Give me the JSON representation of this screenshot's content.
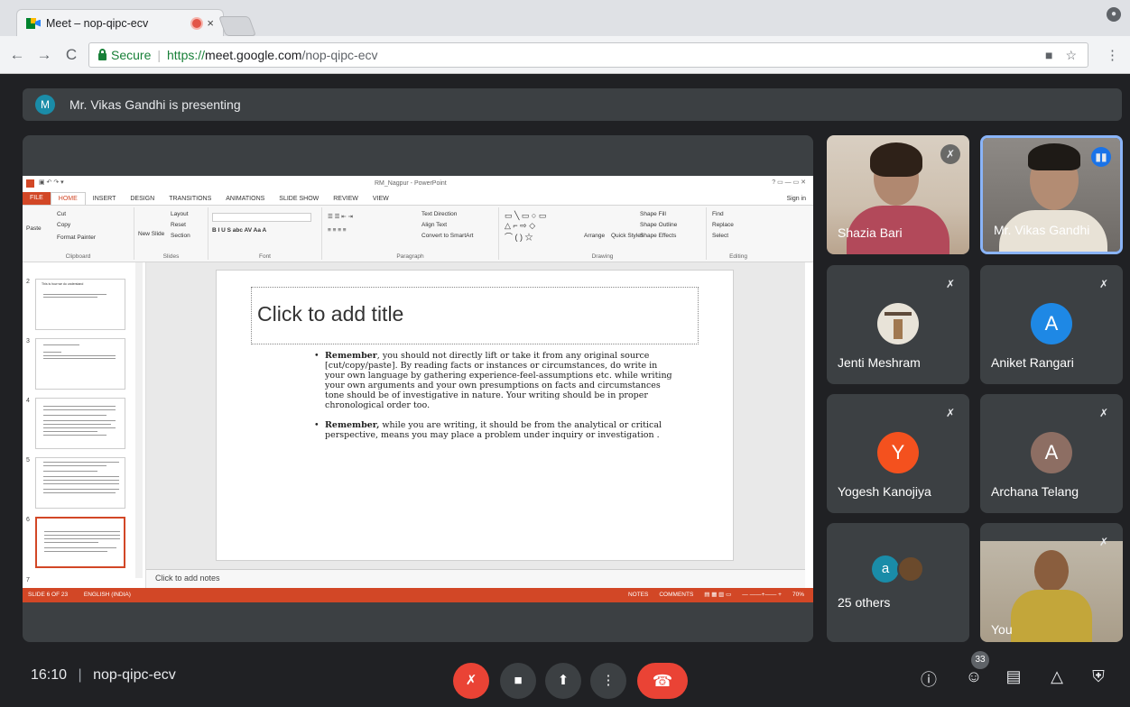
{
  "browser": {
    "tab_title": "Meet – nop-qipc-ecv",
    "tab_close": "×",
    "secure_label": "Secure",
    "url_scheme": "https://",
    "url_host": "meet.google.com",
    "url_path": "/nop-qipc-ecv"
  },
  "banner": {
    "avatar_letter": "M",
    "text": "Mr. Vikas Gandhi is presenting"
  },
  "ppt": {
    "window_title": "RM_Nagpur - PowerPoint",
    "sign_in": "Sign in",
    "tabs": [
      "FILE",
      "HOME",
      "INSERT",
      "DESIGN",
      "TRANSITIONS",
      "ANIMATIONS",
      "SLIDE SHOW",
      "REVIEW",
      "VIEW"
    ],
    "ribbon": {
      "cut": "Cut",
      "copy": "Copy",
      "format_painter": "Format Painter",
      "paste": "Paste",
      "clipboard": "Clipboard",
      "new_slide": "New Slide",
      "layout": "Layout",
      "reset": "Reset",
      "section": "Section",
      "slides": "Slides",
      "font": "Font",
      "text_direction": "Text Direction",
      "align_text": "Align Text",
      "convert_smartart": "Convert to SmartArt",
      "paragraph": "Paragraph",
      "arrange": "Arrange",
      "quick_styles": "Quick Styles",
      "shape_fill": "Shape Fill",
      "shape_outline": "Shape Outline",
      "shape_effects": "Shape Effects",
      "drawing": "Drawing",
      "find": "Find",
      "replace": "Replace",
      "select": "Select",
      "editing": "Editing"
    },
    "slide_numbers": [
      "2",
      "3",
      "4",
      "5",
      "6",
      "7"
    ],
    "thumb2_text": "This is how we do understand",
    "slide_title": "Click to add title",
    "bullet1_bold": "Remember",
    "bullet1_text": ", you should not directly lift or take it from any original source [cut/copy/paste]. By reading facts or instances or circumstances, do write in your own language by gathering experience-feel-assumptions etc. while writing your own arguments and your own presumptions on facts and circumstances tone should be of investigative in nature. Your writing should be in proper chronological order too.",
    "bullet2_bold": "Remember,",
    "bullet2_text": " while you are writing, it should be from the analytical or critical perspective, means you may place a problem under inquiry or investigation .",
    "notes": "Click to add notes",
    "status_slide": "SLIDE 6 OF 23",
    "status_lang": "ENGLISH (INDIA)",
    "status_notes": "NOTES",
    "status_comments": "COMMENTS",
    "zoom": "70%"
  },
  "participants": [
    {
      "name": "Shazia Bari"
    },
    {
      "name": "Mr. Vikas Gandhi"
    },
    {
      "name": "Jenti Meshram"
    },
    {
      "name": "Aniket Rangari",
      "letter": "A",
      "color": "#1e88e5"
    },
    {
      "name": "Yogesh Kanojiya",
      "letter": "Y",
      "color": "#f4511e"
    },
    {
      "name": "Archana Telang",
      "letter": "A",
      "color": "#8d6e63"
    },
    {
      "name": "25 others",
      "letter": "a",
      "color": "#1a8ca8"
    },
    {
      "name": "You"
    }
  ],
  "bottom": {
    "time": "16:10",
    "code": "nop-qipc-ecv",
    "people_count": "33"
  }
}
